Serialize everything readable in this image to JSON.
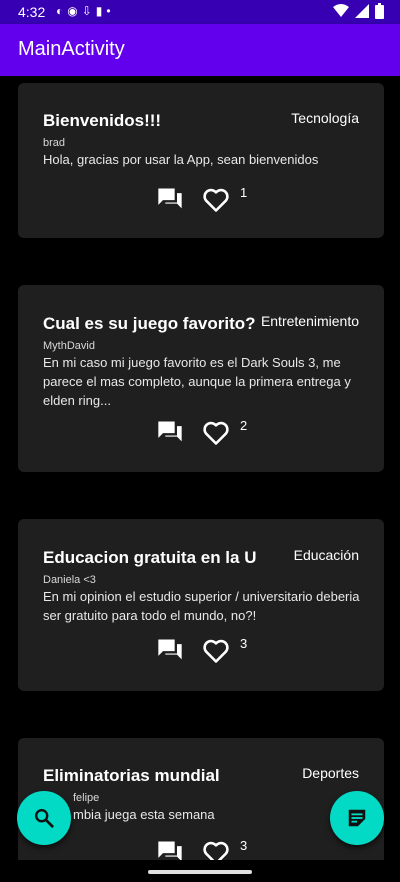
{
  "status_bar": {
    "time": "4:32",
    "left_icons": [
      "shield-icon",
      "shield-icon",
      "download-icon",
      "sd-card-icon",
      "dot-icon"
    ],
    "right_icons": [
      "wifi-icon",
      "signal-icon",
      "battery-icon"
    ]
  },
  "app_bar": {
    "title": "MainActivity",
    "color": "#6200EE"
  },
  "posts": [
    {
      "title": "Bienvenidos!!!",
      "category": "Tecnología",
      "author": "brad",
      "body": "Hola, gracias por usar la App, sean bienvenidos",
      "likes": "1"
    },
    {
      "title": "Cual es su juego favorito?",
      "category": "Entretenimiento",
      "author": "MythDavid",
      "body": "En mi caso mi juego favorito es el Dark Souls 3, me parece el mas completo, aunque la primera entrega y elden ring...",
      "likes": "2"
    },
    {
      "title": "Educacion gratuita en la U",
      "category": "Educación",
      "author": "Daniela <3",
      "body": "En mi opinion el estudio superior / universitario deberia ser gratuito para todo el mundo, no?!",
      "likes": "3"
    },
    {
      "title": "Eliminatorias mundial",
      "category": "Deportes",
      "author": "felipe",
      "body": "mbia juega esta semana",
      "likes": "3"
    }
  ],
  "fab_search": {
    "icon": "search-icon",
    "color": "#03DAC5"
  },
  "fab_new_post": {
    "icon": "new-post-icon",
    "color": "#03DAC5"
  }
}
